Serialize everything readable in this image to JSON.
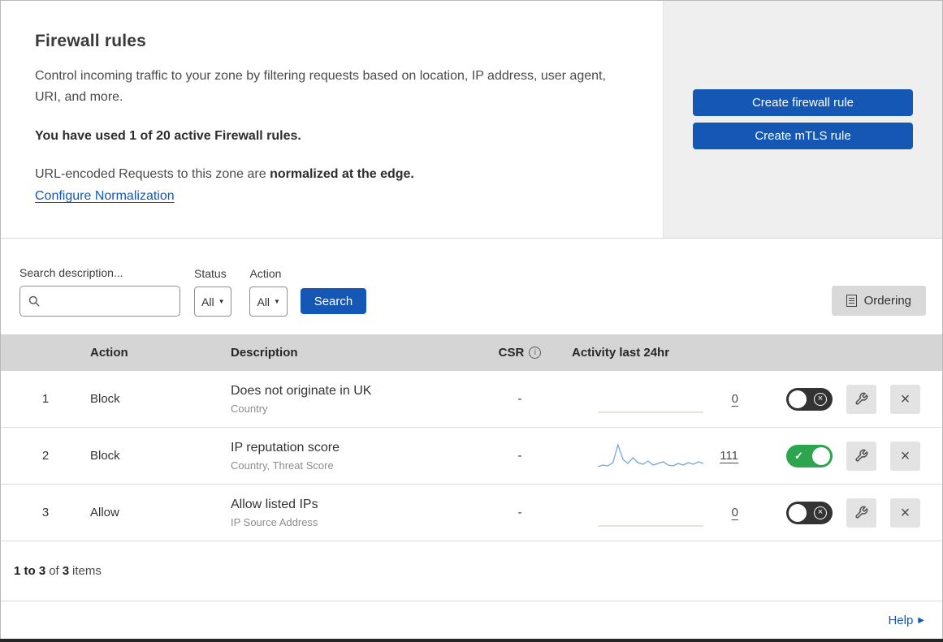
{
  "header": {
    "title": "Firewall rules",
    "description": "Control incoming traffic to your zone by filtering requests based on location, IP address, user agent, URI, and more.",
    "usage": "You have used 1 of 20 active Firewall rules.",
    "normalization_prefix": "URL-encoded Requests to this zone are ",
    "normalization_bold": "normalized at the edge.",
    "normalization_link": "Configure Normalization",
    "create_firewall_rule": "Create firewall rule",
    "create_mtls_rule": "Create mTLS rule"
  },
  "filters": {
    "search_label": "Search description...",
    "status_label": "Status",
    "status_value": "All",
    "action_label": "Action",
    "action_value": "All",
    "search_button": "Search",
    "ordering_button": "Ordering"
  },
  "table": {
    "headers": {
      "action": "Action",
      "description": "Description",
      "csr": "CSR",
      "activity": "Activity last 24hr"
    },
    "rows": [
      {
        "num": "1",
        "action": "Block",
        "description": "Does not originate in UK",
        "criteria": "Country",
        "csr": "-",
        "activity": "0",
        "enabled": false,
        "sparkline": [
          0,
          0,
          0,
          0,
          0,
          0,
          0,
          0,
          0,
          0,
          0,
          0,
          0,
          0,
          0,
          0,
          0,
          0,
          0,
          0
        ],
        "sparkline_color": "#d6d2c8"
      },
      {
        "num": "2",
        "action": "Block",
        "description": "IP reputation score",
        "criteria": "Country, Threat Score",
        "csr": "-",
        "activity": "111",
        "enabled": true,
        "sparkline": [
          3,
          5,
          4,
          8,
          30,
          12,
          7,
          14,
          8,
          6,
          10,
          5,
          7,
          9,
          5,
          4,
          7,
          5,
          8,
          6,
          9,
          7
        ],
        "sparkline_color": "#74a7d8"
      },
      {
        "num": "3",
        "action": "Allow",
        "description": "Allow listed IPs",
        "criteria": "IP Source Address",
        "csr": "-",
        "activity": "0",
        "enabled": false,
        "sparkline": [
          0,
          0,
          0,
          0,
          0,
          0,
          0,
          0,
          0,
          0,
          0,
          0,
          0,
          0,
          0,
          0,
          0,
          0,
          0,
          0
        ],
        "sparkline_color": "#d6d2c8"
      }
    ]
  },
  "footer": {
    "range": "1 to 3",
    "of": "of",
    "total": "3",
    "items": "items"
  },
  "help": {
    "label": "Help"
  },
  "icons": {
    "check": "✓",
    "close": "×",
    "dropdown_arrow": "▼",
    "info": "i",
    "help_arrow": "▶"
  },
  "colors": {
    "primary_blue": "#1557b5",
    "toggle_on_green": "#2da44e",
    "toggle_off_dark": "#333333",
    "sparkline_blue": "#74a7d8",
    "sparkline_flat": "#d6d2c8",
    "table_header_gray": "#d5d5d5",
    "panel_gray": "#efefef"
  }
}
